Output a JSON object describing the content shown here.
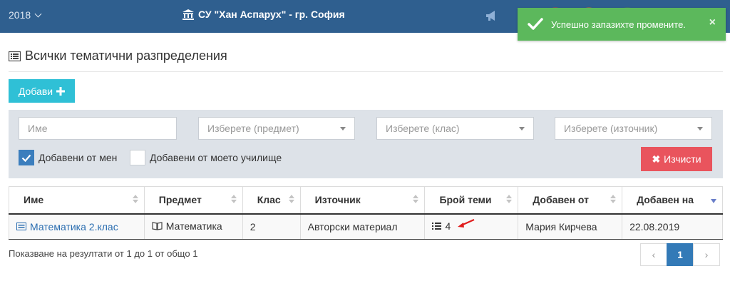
{
  "topbar": {
    "year": "2018",
    "school_title": "СУ \"Хан Аспарух\" - гр. София",
    "announce_icon": "megaphone-icon"
  },
  "toast": {
    "message": "Успешно запазихте промените.",
    "close": "×"
  },
  "page": {
    "title": "Всички тематични разпределения",
    "add_button": "Добави"
  },
  "filters": {
    "name_placeholder": "Име",
    "subject_placeholder": "Изберете (предмет)",
    "class_placeholder": "Изберете (клас)",
    "source_placeholder": "Изберете (източник)",
    "added_by_me_label": "Добавени от мен",
    "added_by_me_checked": true,
    "added_by_school_label": "Добавени от моето училище",
    "added_by_school_checked": false,
    "clear_button": "Изчисти"
  },
  "table": {
    "headers": [
      "Име",
      "Предмет",
      "Клас",
      "Източник",
      "Брой теми",
      "Добавен от",
      "Добавен на"
    ],
    "rows": [
      {
        "name": "Математика 2.клас",
        "subject": "Математика",
        "class": "2",
        "source": "Авторски материал",
        "topics": "4",
        "added_by": "Мария Кирчева",
        "added_on": "22.08.2019"
      }
    ]
  },
  "footer": {
    "summary": "Показване на резултати от 1 до 1 от общо 1",
    "pagination": {
      "prev": "‹",
      "current": "1",
      "next": "›"
    }
  },
  "colors": {
    "topbar": "#2f5f8f",
    "toast": "#5cb85c",
    "add_button": "#2fc0d6",
    "clear_button": "#e9545d",
    "checkbox": "#3b7ebd",
    "pager_active": "#337ab7"
  }
}
